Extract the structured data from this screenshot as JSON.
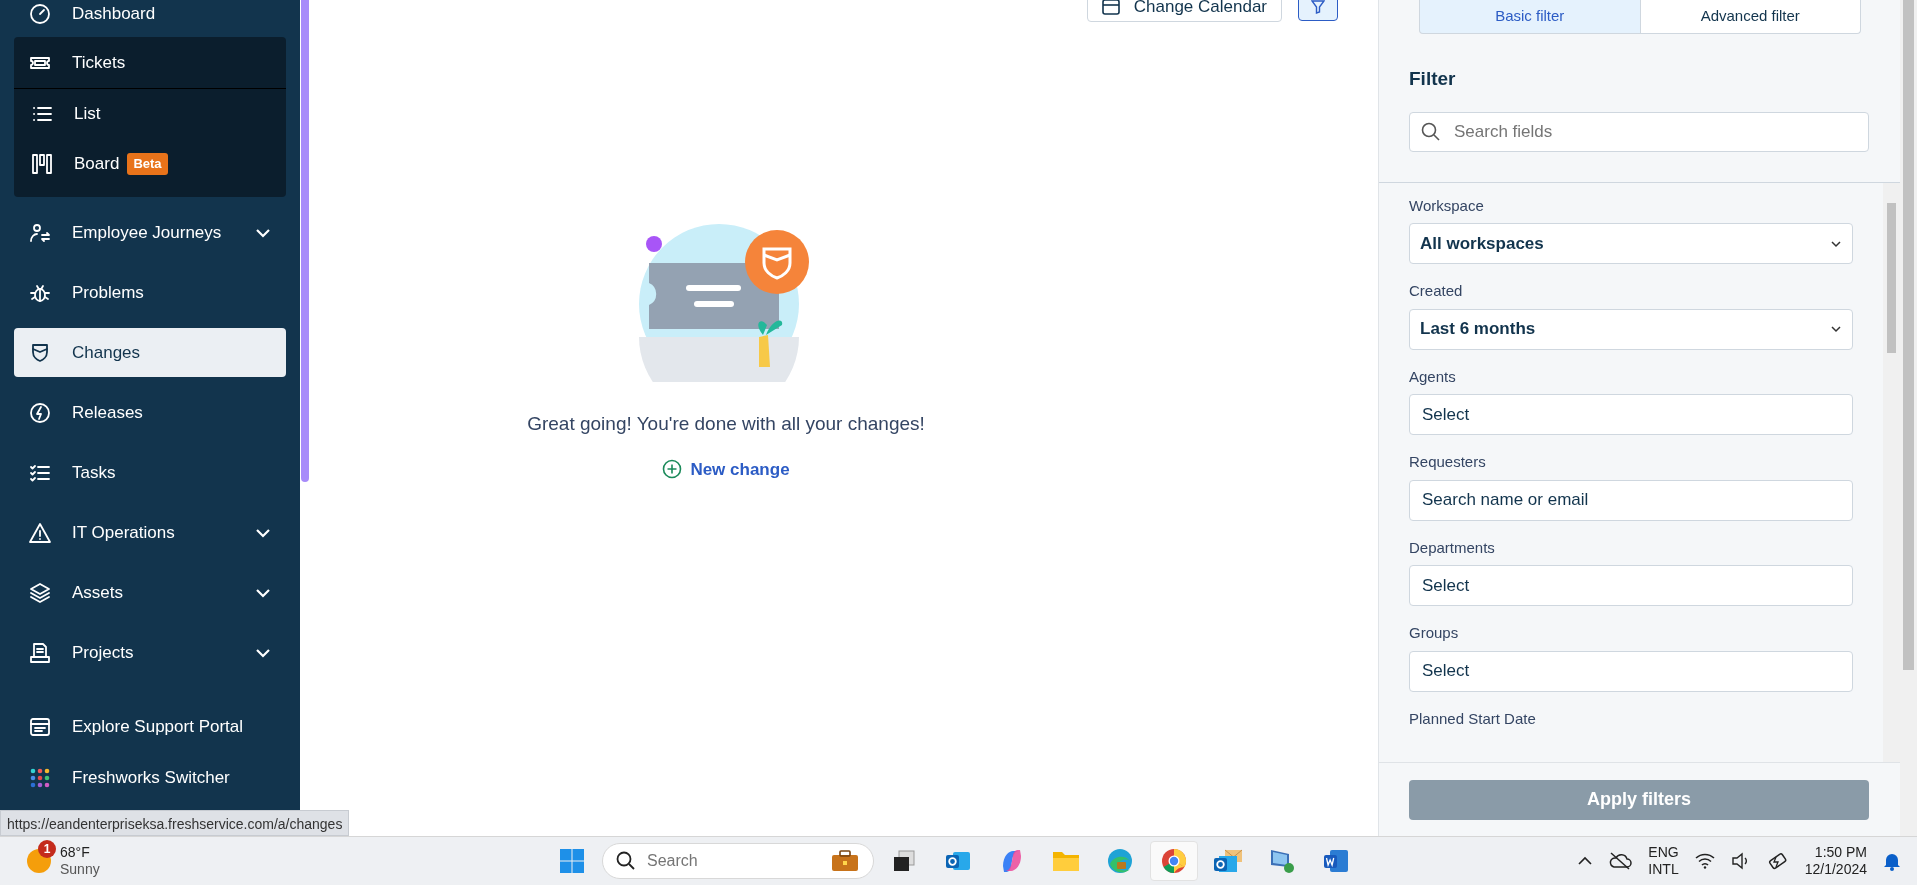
{
  "sidebar": {
    "items": [
      {
        "label": "Dashboard",
        "selected": false,
        "has_menu": false
      },
      {
        "label": "Tickets",
        "selected": false,
        "has_menu": false,
        "expanded": true,
        "children": [
          {
            "label": "List",
            "selected": false
          },
          {
            "label": "Board",
            "selected": false,
            "badge": "Beta"
          }
        ]
      },
      {
        "label": "Employee Journeys",
        "selected": false,
        "has_menu": true
      },
      {
        "label": "Problems",
        "selected": false,
        "has_menu": false
      },
      {
        "label": "Changes",
        "selected": true,
        "has_menu": false
      },
      {
        "label": "Releases",
        "selected": false,
        "has_menu": false
      },
      {
        "label": "Tasks",
        "selected": false,
        "has_menu": false
      },
      {
        "label": "IT Operations",
        "selected": false,
        "has_menu": true
      },
      {
        "label": "Assets",
        "selected": false,
        "has_menu": true
      },
      {
        "label": "Projects",
        "selected": false,
        "has_menu": true
      }
    ],
    "footer_items": [
      {
        "label": "Explore Support Portal"
      },
      {
        "label": "Freshworks Switcher"
      }
    ]
  },
  "toolbar": {
    "calendar_button": "Change Calendar"
  },
  "empty_state": {
    "message": "Great going! You're done with all your changes!",
    "action": "New change"
  },
  "filter_panel": {
    "tabs": [
      {
        "label": "Basic filter",
        "selected": true
      },
      {
        "label": "Advanced filter",
        "selected": false
      }
    ],
    "title": "Filter",
    "search": {
      "placeholder": "Search fields"
    },
    "fields": [
      {
        "label": "Workspace",
        "kind": "select",
        "value": "All workspaces"
      },
      {
        "label": "Created",
        "kind": "select",
        "value": "Last 6 months"
      },
      {
        "label": "Agents",
        "kind": "picker",
        "value": "Select"
      },
      {
        "label": "Requesters",
        "kind": "picker",
        "value": "Search name or email"
      },
      {
        "label": "Departments",
        "kind": "picker",
        "value": "Select"
      },
      {
        "label": "Groups",
        "kind": "picker",
        "value": "Select"
      },
      {
        "label": "Planned Start Date",
        "kind": "heading"
      }
    ],
    "apply_button": "Apply filters"
  },
  "status_url": "https://eandenterpriseksa.freshservice.com/a/changes",
  "taskbar": {
    "weather": {
      "badge": "1",
      "temperature": "68°F",
      "condition": "Sunny"
    },
    "search": {
      "placeholder": "Search"
    },
    "apps": [
      {
        "selected": false
      },
      {
        "selected": false
      },
      {
        "selected": false
      },
      {
        "selected": false
      },
      {
        "selected": false
      },
      {
        "selected": false
      },
      {
        "selected": true
      },
      {
        "selected": false
      },
      {
        "selected": false
      },
      {
        "selected": false
      }
    ],
    "language": {
      "line_1": "ENG",
      "line_2": "INTL"
    },
    "time": "1:50 PM",
    "date": "12/1/2024"
  }
}
